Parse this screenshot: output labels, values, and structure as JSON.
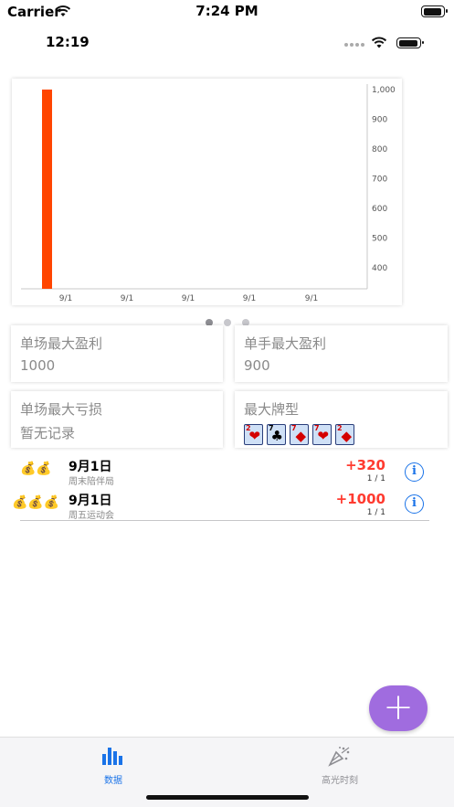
{
  "status_outer": {
    "carrier": "Carrier",
    "time": "7:24 PM"
  },
  "status_inner": {
    "time": "12:19"
  },
  "chart_data": {
    "type": "bar",
    "categories": [
      "9/1",
      "9/1"
    ],
    "values": [
      320,
      1000
    ],
    "y_axis_side": "right",
    "ylim": [
      330,
      1000
    ],
    "y_ticks": [
      "1,000",
      "900",
      "800",
      "700",
      "600",
      "500",
      "400"
    ],
    "x_ticks": [
      "9/1",
      "9/1",
      "9/1",
      "9/1",
      "9/1"
    ],
    "bar_color": "#ff4500",
    "grid": false
  },
  "pager": {
    "count": 3,
    "active": 0
  },
  "stats": {
    "max_win_session": {
      "title": "单场最大盈利",
      "value": "1000"
    },
    "max_win_hand": {
      "title": "单手最大盈利",
      "value": "900"
    },
    "max_loss_session": {
      "title": "单场最大亏损",
      "value": "暂无记录"
    },
    "best_hand": {
      "title": "最大牌型",
      "cards": [
        {
          "rank": "2",
          "suit": "❤",
          "color": "#d40000"
        },
        {
          "rank": "7",
          "suit": "♣",
          "color": "#000000"
        },
        {
          "rank": "7",
          "suit": "◆",
          "color": "#d40000"
        },
        {
          "rank": "7",
          "suit": "❤",
          "color": "#d40000"
        },
        {
          "rank": "2",
          "suit": "◆",
          "color": "#d40000"
        }
      ]
    }
  },
  "records": [
    {
      "money": "💰💰",
      "date": "9月1日",
      "subtitle": "周末陪伴局",
      "amount": "+320",
      "fraction": "1 / 1",
      "info": "i"
    },
    {
      "money": "💰💰💰",
      "date": "9月1日",
      "subtitle": "周五运动会",
      "amount": "+1000",
      "fraction": "1 / 1",
      "info": "i"
    }
  ],
  "fab": {
    "label": "+",
    "color": "#a06cdf"
  },
  "tabbar": {
    "tabs": [
      {
        "label": "数据",
        "icon": "bar-chart-icon",
        "active": true,
        "color": "#1a73e8"
      },
      {
        "label": "高光时刻",
        "icon": "party-popper-icon",
        "active": false,
        "color": "#8e8e93"
      }
    ]
  },
  "colors": {
    "accent": "#1a73e8",
    "profit": "#ff3b30",
    "fab": "#a06cdf"
  }
}
